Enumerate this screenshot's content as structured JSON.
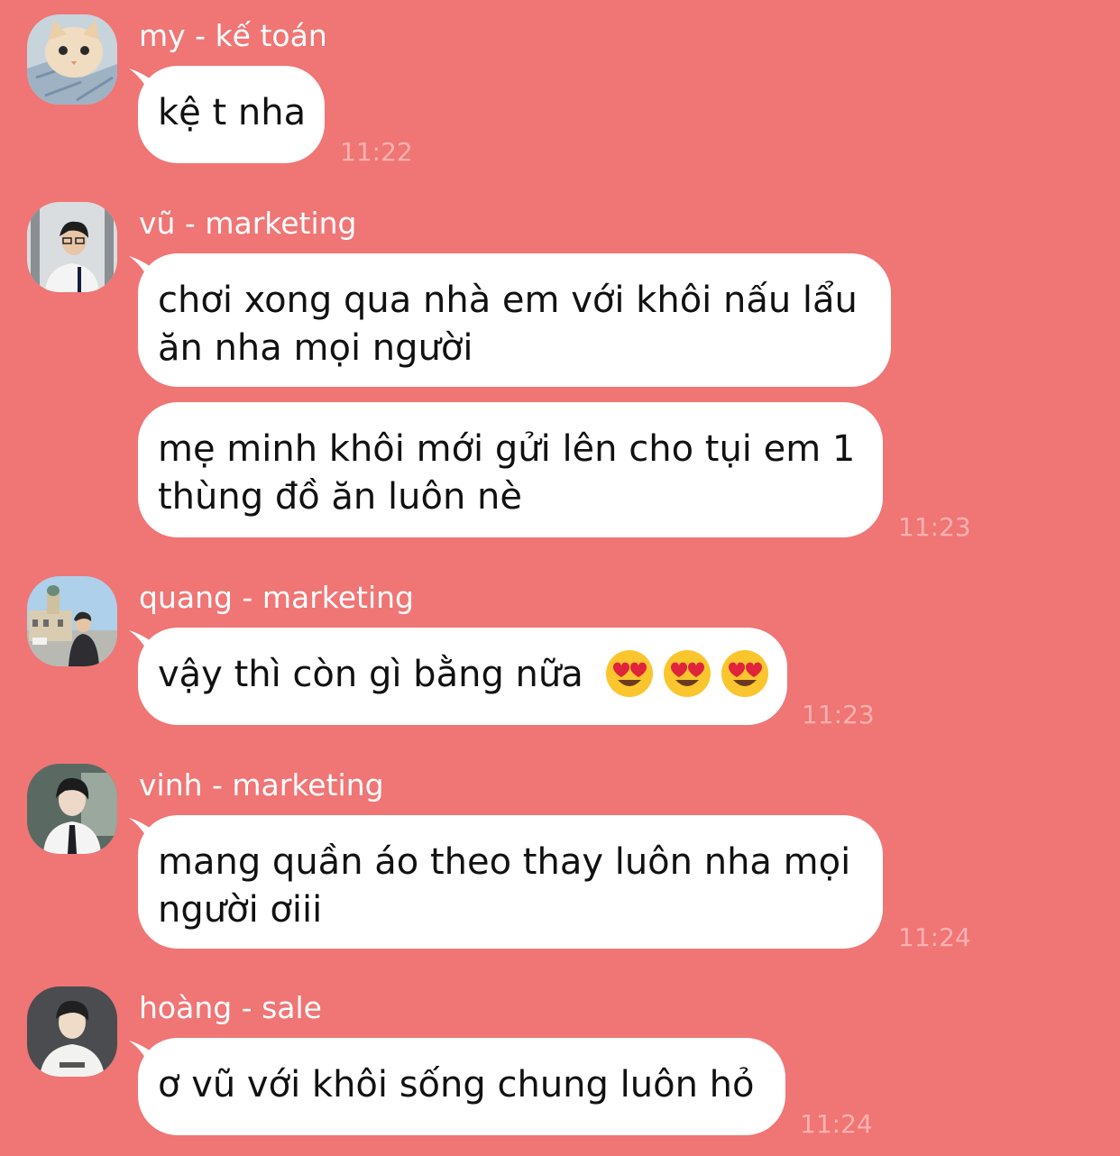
{
  "colors": {
    "background": "#f07575",
    "bubble": "#ffffff",
    "sender_text": "#ffffff",
    "timestamp": "#ffb1b1",
    "message_text": "#111111"
  },
  "messages": [
    {
      "sender": "my - kế toán",
      "avatar_icon": "kitten-avatar",
      "bubbles": [
        {
          "text": "kệ t nha"
        }
      ],
      "time": "11:22"
    },
    {
      "sender": "vũ - marketing",
      "avatar_icon": "man-photo-avatar",
      "bubbles": [
        {
          "line1": "chơi xong qua nhà em với khôi nấu lẩu",
          "line2": "ăn nha mọi người"
        },
        {
          "line1": "mẹ minh khôi mới gửi lên cho tụi em 1",
          "line2": "thùng đồ ăn luôn nè"
        }
      ],
      "time": "11:23"
    },
    {
      "sender": "quang - marketing",
      "avatar_icon": "city-photo-avatar",
      "bubbles": [
        {
          "text": "vậy thì còn gì bằng nữa",
          "emoji": "heart-eyes-emoji",
          "emoji_count": 3
        }
      ],
      "time": "11:23"
    },
    {
      "sender": "vinh - marketing",
      "avatar_icon": "man-tie-photo-avatar",
      "bubbles": [
        {
          "line1": "mang quần áo theo thay luôn nha mọi",
          "line2": "người ơiii"
        }
      ],
      "time": "11:24"
    },
    {
      "sender": "hoàng - sale",
      "avatar_icon": "man-tshirt-photo-avatar",
      "bubbles": [
        {
          "text": "ơ vũ với khôi sống chung luôn hỏ"
        }
      ],
      "time": "11:24"
    }
  ]
}
